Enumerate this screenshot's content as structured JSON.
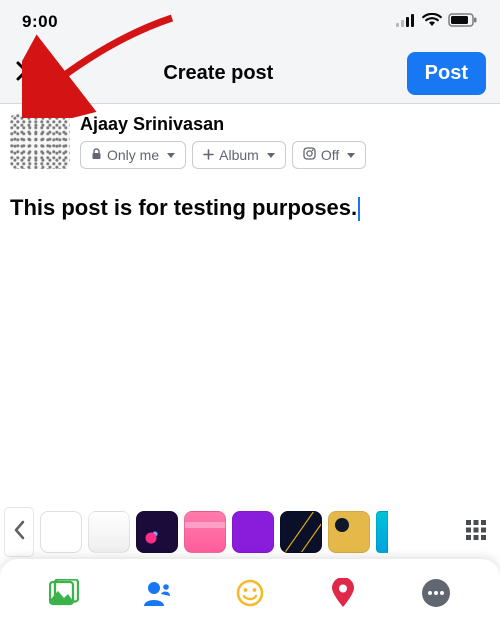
{
  "status": {
    "time": "9:00"
  },
  "header": {
    "title": "Create post",
    "post_button_label": "Post"
  },
  "user": {
    "name": "Ajaay Srinivasan"
  },
  "privacy_pill": {
    "label": "Only me"
  },
  "album_pill": {
    "label": "Album"
  },
  "instagram_pill": {
    "label": "Off"
  },
  "composer": {
    "text": "This post is for testing purposes."
  },
  "background_swatches": [
    {
      "id": "plain",
      "name": "plain-white"
    },
    {
      "id": "gray",
      "name": "light-gray-pattern"
    },
    {
      "id": "rocket",
      "name": "rocket-purple"
    },
    {
      "id": "folder",
      "name": "pink-folder"
    },
    {
      "id": "purple",
      "name": "solid-purple"
    },
    {
      "id": "meteor",
      "name": "dark-meteor"
    },
    {
      "id": "yellow",
      "name": "yellow-illustration"
    },
    {
      "id": "teal",
      "name": "teal-gradient"
    }
  ],
  "annotation": {
    "note": "Red arrow pointing at the close (X) button"
  }
}
